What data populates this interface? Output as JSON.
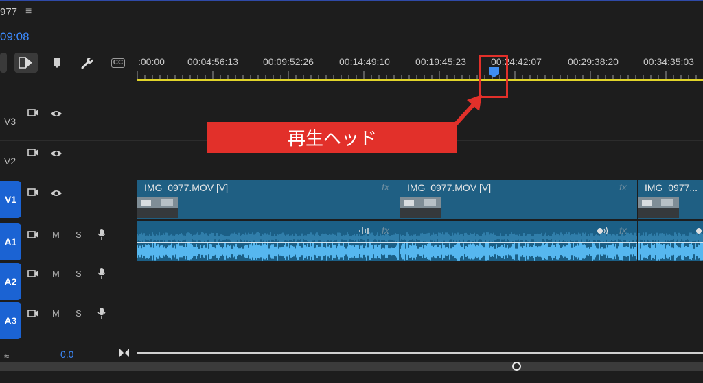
{
  "header": {
    "sequence_name": "977",
    "menu_icon": "≡",
    "current_timecode": "09:08"
  },
  "toolbar": {
    "icons": [
      "snap-icon",
      "linked-selection-icon",
      "marker-icon",
      "wrench-icon",
      "captions-icon"
    ],
    "captions_label": "CC"
  },
  "ruler": {
    "labels": [
      ":00:00",
      "00:04:56:13",
      "00:09:52:26",
      "00:14:49:10",
      "00:19:45:23",
      "00:24:42:07",
      "00:29:38:20",
      "00:34:35:03"
    ]
  },
  "tracks": {
    "video": [
      {
        "name": "V3",
        "targeted": false
      },
      {
        "name": "V2",
        "targeted": false
      },
      {
        "name": "V1",
        "targeted": true
      }
    ],
    "audio": [
      {
        "name": "A1",
        "mute": "M",
        "solo": "S"
      },
      {
        "name": "A2",
        "mute": "M",
        "solo": "S"
      },
      {
        "name": "A3",
        "mute": "M",
        "solo": "S"
      }
    ],
    "master_value": "0.0"
  },
  "clips": {
    "video": [
      {
        "title": "IMG_0977.MOV [V]",
        "fx": "fx"
      },
      {
        "title": "IMG_0977.MOV [V]",
        "fx": "fx"
      },
      {
        "title": "IMG_0977...",
        "fx": ""
      }
    ],
    "audio_fx": "fx"
  },
  "annotation": {
    "callout_text": "再生ヘッド",
    "color": "#e2302a"
  },
  "colors": {
    "accent": "#3d8bff",
    "track_target": "#1b63d3",
    "clip": "#1f5f83",
    "waveform": "#56b7ef",
    "work_area": "#e1d42a"
  }
}
